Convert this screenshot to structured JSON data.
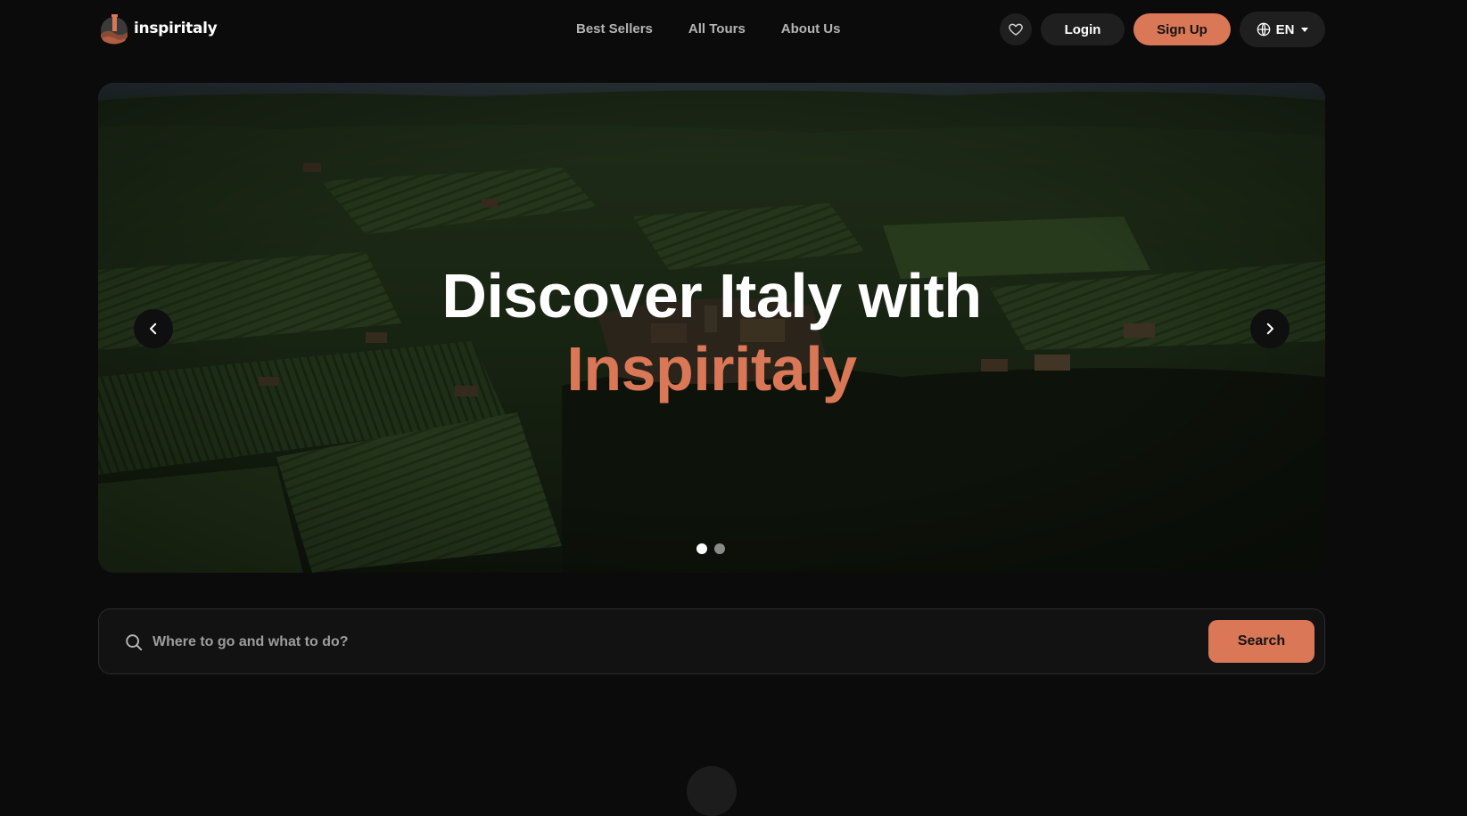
{
  "brand": {
    "name": "inspiritaly",
    "accent_color": "#d97757",
    "logo_icon": "tower-logo-icon"
  },
  "nav": {
    "items": [
      {
        "label": "Best Sellers"
      },
      {
        "label": "All Tours"
      },
      {
        "label": "About Us"
      }
    ]
  },
  "header_actions": {
    "favorites_icon": "heart-icon",
    "login_label": "Login",
    "signup_label": "Sign Up",
    "language_icon": "globe-icon",
    "language_label": "EN"
  },
  "hero": {
    "title_line1": "Discover Italy with",
    "title_line2": "Inspiritaly",
    "prev_icon": "chevron-left-icon",
    "next_icon": "chevron-right-icon",
    "slide_count": 2,
    "active_slide": 1
  },
  "search": {
    "placeholder": "Where to go and what to do?",
    "value": "",
    "button_label": "Search",
    "icon": "search-icon"
  }
}
